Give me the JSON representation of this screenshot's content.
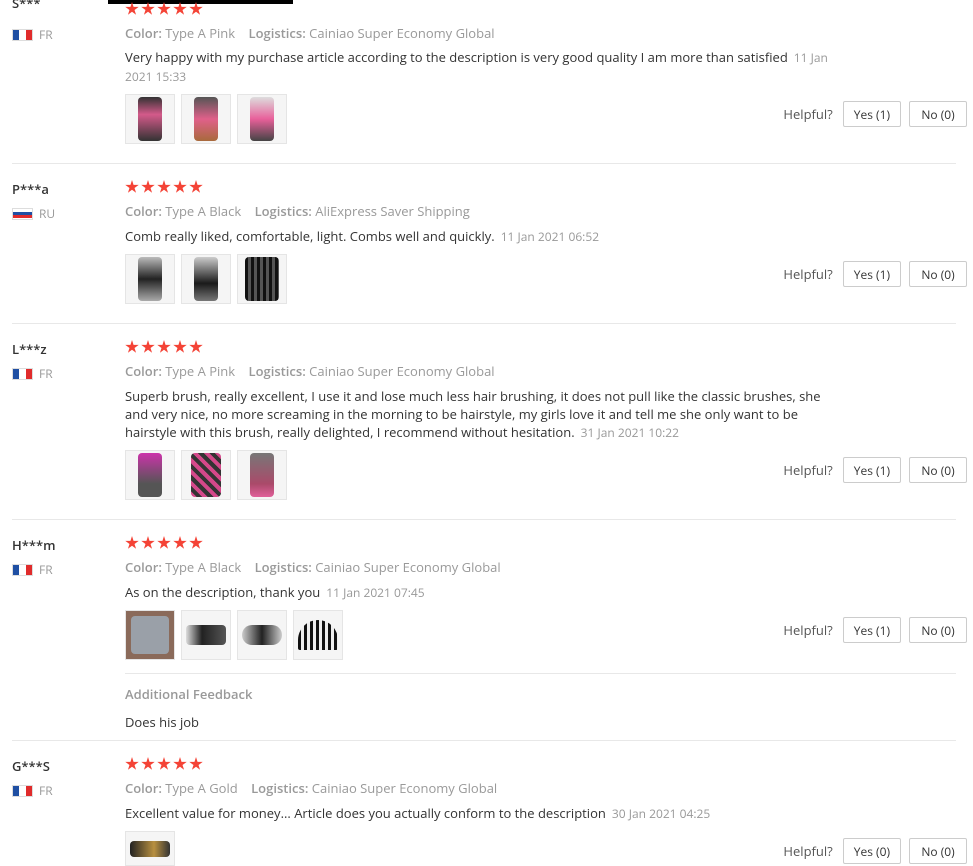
{
  "helpful_label": "Helpful?",
  "colors": {
    "star": "#f44336",
    "meta": "#999999",
    "text": "#333333"
  },
  "reviews": [
    {
      "user": "S***",
      "country": "FR",
      "rating": 5,
      "color_label": "Color:",
      "color_value": "Type A Pink",
      "logistics_label": "Logistics:",
      "logistics_value": "Cainiao Super Economy Global",
      "text": "Very happy with my purchase article according to the description is very good quality I am more than satisfied",
      "date": "11 Jan 2021 15:33",
      "photos": 3,
      "yes": "Yes (1)",
      "no": "No (0)"
    },
    {
      "user": "P***a",
      "country": "RU",
      "rating": 5,
      "color_label": "Color:",
      "color_value": "Type A Black",
      "logistics_label": "Logistics:",
      "logistics_value": "AliExpress Saver Shipping",
      "text": "Comb really liked, comfortable, light. Combs well and quickly.",
      "date": "11 Jan 2021 06:52",
      "photos": 3,
      "yes": "Yes (1)",
      "no": "No (0)"
    },
    {
      "user": "L***z",
      "country": "FR",
      "rating": 5,
      "color_label": "Color:",
      "color_value": "Type A Pink",
      "logistics_label": "Logistics:",
      "logistics_value": "Cainiao Super Economy Global",
      "text": "Superb brush, really excellent, I use it and lose much less hair brushing, it does not pull like the classic brushes, she and very nice, no more screaming in the morning to be hairstyle, my girls love it and tell me she only want to be hairstyle with this brush, really delighted, I recommend without hesitation.",
      "date": "31 Jan 2021 10:22",
      "photos": 3,
      "yes": "Yes (1)",
      "no": "No (0)"
    },
    {
      "user": "H***m",
      "country": "FR",
      "rating": 5,
      "color_label": "Color:",
      "color_value": "Type A Black",
      "logistics_label": "Logistics:",
      "logistics_value": "Cainiao Super Economy Global",
      "text": "As on the description, thank you",
      "date": "11 Jan 2021 07:45",
      "photos": 4,
      "yes": "Yes (1)",
      "no": "No (0)",
      "additional_title": "Additional Feedback",
      "additional_text": "Does his job"
    },
    {
      "user": "G***S",
      "country": "FR",
      "rating": 5,
      "color_label": "Color:",
      "color_value": "Type A Gold",
      "logistics_label": "Logistics:",
      "logistics_value": "Cainiao Super Economy Global",
      "text": "Excellent value for money... Article does you actually conform to the description",
      "date": "30 Jan 2021 04:25",
      "photos": 1,
      "yes": "Yes (0)",
      "no": "No (0)"
    }
  ]
}
